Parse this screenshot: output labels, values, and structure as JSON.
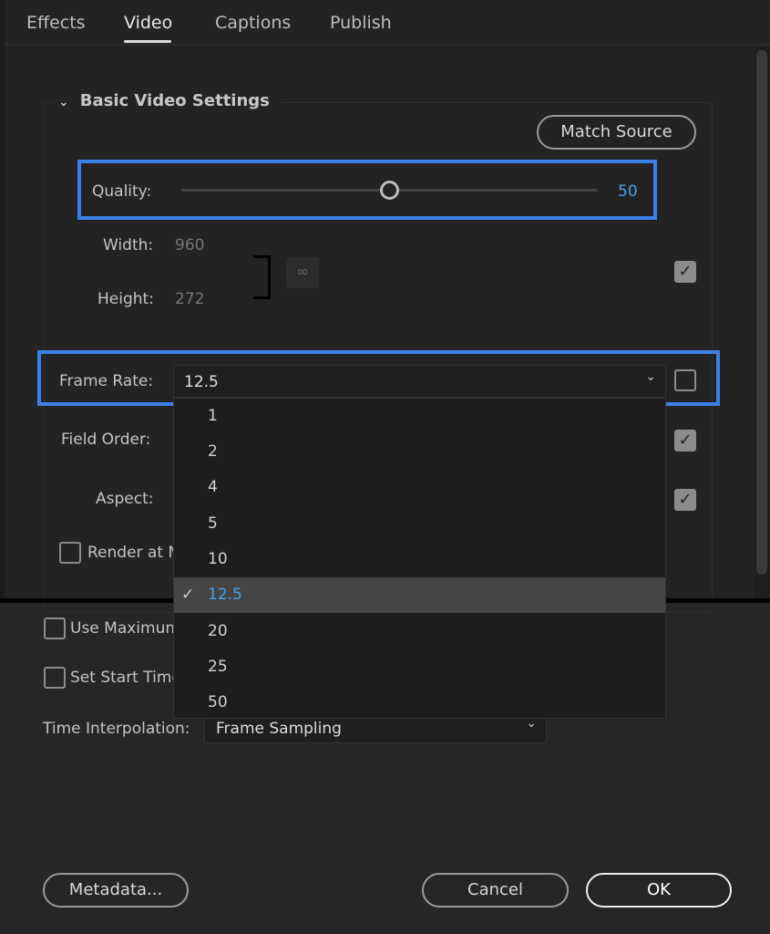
{
  "tabs": [
    {
      "label": "Effects"
    },
    {
      "label": "Video"
    },
    {
      "label": "Captions"
    },
    {
      "label": "Publish"
    }
  ],
  "section": {
    "title": "Basic Video Settings",
    "match_source": "Match Source"
  },
  "quality": {
    "label": "Quality:",
    "value": "50",
    "slider_percent": 50
  },
  "width": {
    "label": "Width:",
    "value": "960"
  },
  "height": {
    "label": "Height:",
    "value": "272"
  },
  "frame_rate": {
    "label": "Frame Rate:",
    "value": "12.5",
    "options": [
      "1",
      "2",
      "4",
      "5",
      "10",
      "12.5",
      "20",
      "25",
      "50"
    ],
    "selected": "12.5"
  },
  "field_order": {
    "label": "Field Order:"
  },
  "aspect": {
    "label": "Aspect:"
  },
  "render_max": {
    "label": "Render at M"
  },
  "use_max": {
    "label": "Use Maximum"
  },
  "start_time": {
    "label": "Set Start Time"
  },
  "time_interp": {
    "label": "Time Interpolation:",
    "value": "Frame Sampling"
  },
  "footer": {
    "metadata": "Metadata...",
    "cancel": "Cancel",
    "ok": "OK"
  },
  "colors": {
    "highlight": "#3c82e6",
    "accent": "#4aa0ee"
  }
}
